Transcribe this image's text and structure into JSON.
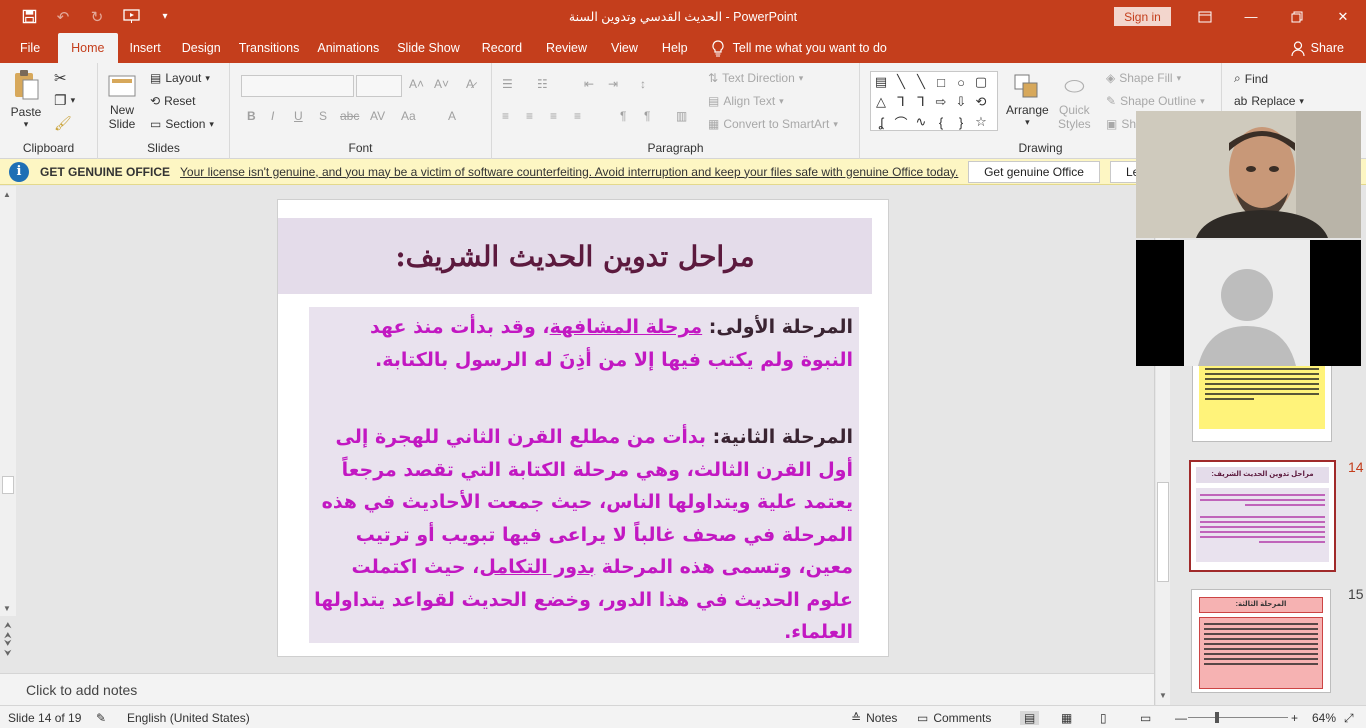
{
  "window": {
    "title": "الحديث القدسي وتدوين السنة  -  PowerPoint",
    "sign_in": "Sign in"
  },
  "tabs": [
    "File",
    "Home",
    "Insert",
    "Design",
    "Transitions",
    "Animations",
    "Slide Show",
    "Record",
    "Review",
    "View",
    "Help"
  ],
  "active_tab": "Home",
  "tell_me": "Tell me what you want to do",
  "share": "Share",
  "ribbon": {
    "clipboard": {
      "label": "Clipboard",
      "paste": "Paste"
    },
    "slides": {
      "label": "Slides",
      "new_slide": "New",
      "new_slide2": "Slide",
      "layout": "Layout",
      "reset": "Reset",
      "section": "Section"
    },
    "font": {
      "label": "Font"
    },
    "paragraph": {
      "label": "Paragraph",
      "text_direction": "Text Direction",
      "align_text": "Align Text",
      "convert_smartart": "Convert to SmartArt"
    },
    "drawing": {
      "label": "Drawing",
      "arrange": "Arrange",
      "quick_styles": "Quick",
      "quick_styles2": "Styles",
      "shape_fill": "Shape Fill",
      "shape_outline": "Shape Outline",
      "shape_effects": "Sh"
    },
    "editing": {
      "find": "Find",
      "replace": "Replace"
    }
  },
  "infobar": {
    "title": "GET GENUINE OFFICE",
    "message": "Your license isn't genuine, and you may be a victim of software counterfeiting. Avoid interruption and keep your files safe with genuine Office today.",
    "button": "Get genuine Office",
    "button2": "Le"
  },
  "slide": {
    "title": "مراحل تدوين الحديث الشريف:",
    "p1": {
      "lead": "المرحلة الأولى: ",
      "u": "مرحلة المشافهة",
      "rest": "، وقد بدأت منذ عهد النبوة ولم يكتب فيها إلا من أذِنَ له الرسول بالكتابة."
    },
    "p2": {
      "lead": "المرحلة الثانية: ",
      "text1": "بدأت من مطلع القرن الثاني للهجرة إلى أول القرن الثالث، وهي مرحلة الكتابة التي تقصد مرجعاً يعتمد علية ويتداولها الناس، حيث جمعت الأحاديث في هذه المرحلة في صحف غالباً لا يراعى فيها تبويب أو ترتيب معين، وتسمى هذه المرحلة ",
      "u": "بدور التكامل",
      "text2": "، حيث اكتملت علوم الحديث في هذا الدور، وخضع الحديث لقواعد يتداولها العلماء."
    }
  },
  "notes_placeholder": "Click to add notes",
  "thumbnails": [
    {
      "num": "14",
      "title": "مراحل تدوين الحديث الشريف:",
      "active": true
    },
    {
      "num": "15",
      "title": "المرحلة الثالثة:",
      "active": false
    }
  ],
  "status": {
    "slide_info": "Slide 14 of 19",
    "language": "English (United States)",
    "notes": "Notes",
    "comments": "Comments",
    "zoom": "64%"
  },
  "colors": {
    "accent": "#c43e1c",
    "slide_title": "#5c1a3e",
    "slide_text": "#c218c2",
    "info_bar": "#fdf6c3"
  }
}
